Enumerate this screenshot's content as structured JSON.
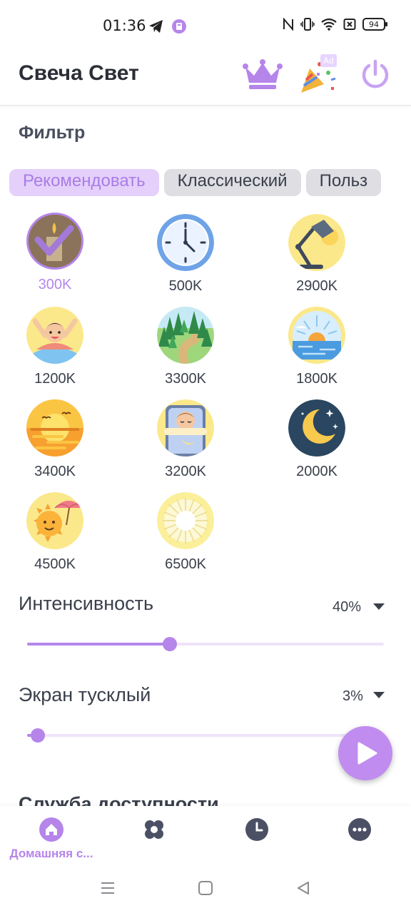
{
  "status_bar": {
    "time": "01:36",
    "battery": "94"
  },
  "app_bar": {
    "title": "Свеча Свет",
    "ad_badge": "Ad"
  },
  "filter": {
    "title": "Фильтр",
    "tabs": [
      {
        "label": "Рекомендовать",
        "active": true
      },
      {
        "label": "Классический",
        "active": false
      },
      {
        "label": "Польз",
        "active": false
      }
    ],
    "presets": [
      {
        "label": "300K",
        "icon": "candle-icon",
        "selected": true
      },
      {
        "label": "500K",
        "icon": "clock-icon",
        "selected": false
      },
      {
        "label": "2900K",
        "icon": "desk-lamp-icon",
        "selected": false
      },
      {
        "label": "1200K",
        "icon": "happy-kid-icon",
        "selected": false
      },
      {
        "label": "3300K",
        "icon": "forest-icon",
        "selected": false
      },
      {
        "label": "1800K",
        "icon": "sunrise-sea-icon",
        "selected": false
      },
      {
        "label": "3400K",
        "icon": "sunset-icon",
        "selected": false
      },
      {
        "label": "3200K",
        "icon": "sleeping-kid-icon",
        "selected": false
      },
      {
        "label": "2000K",
        "icon": "moon-stars-icon",
        "selected": false
      },
      {
        "label": "4500K",
        "icon": "sun-umbrella-icon",
        "selected": false
      },
      {
        "label": "6500K",
        "icon": "bright-light-icon",
        "selected": false
      }
    ]
  },
  "intensity": {
    "label": "Интенсивность",
    "value": "40%",
    "fraction": 0.4
  },
  "dim_screen": {
    "label": "Экран тусклый",
    "value": "3%",
    "fraction": 0.03
  },
  "accessibility_section": {
    "title": "Служба доступности"
  },
  "bottom_nav": {
    "items": [
      {
        "label": "Домашняя с...",
        "icon": "home-icon",
        "active": true
      },
      {
        "label": "",
        "icon": "flower-icon",
        "active": false
      },
      {
        "label": "",
        "icon": "clock-icon",
        "active": false
      },
      {
        "label": "",
        "icon": "more-icon",
        "active": false
      }
    ]
  },
  "colors": {
    "accent": "#b585ea",
    "accent_light": "#e4d0fb",
    "text": "#3a3f4b",
    "tab_bg": "#dedee3"
  }
}
